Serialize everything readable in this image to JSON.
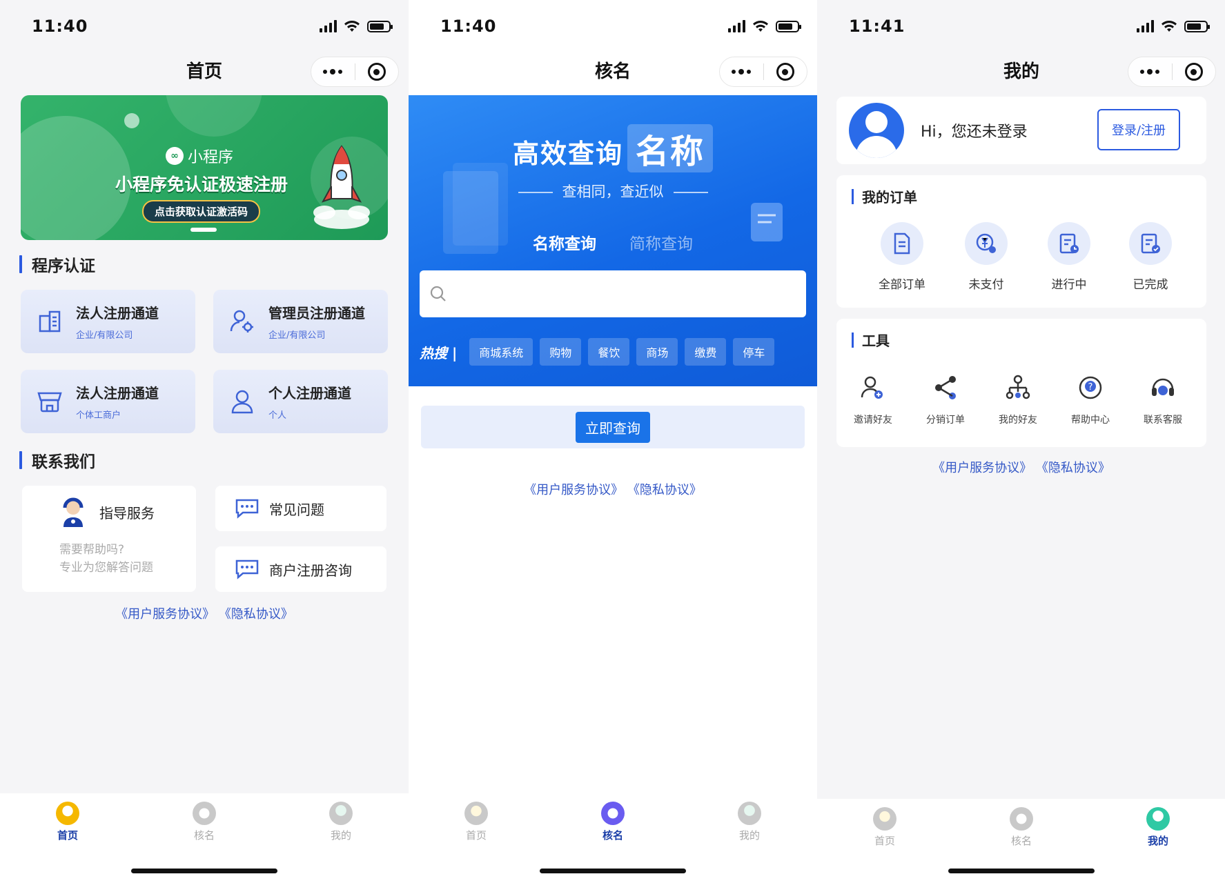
{
  "screens": [
    {
      "time": "11:40",
      "title": "首页",
      "banner": {
        "brand": "小程序",
        "headline": "小程序免认证极速注册",
        "cta": "点击获取认证激活码"
      },
      "section_auth": "程序认证",
      "auth_cards": [
        {
          "title": "法人注册通道",
          "sub": "企业/有限公司",
          "icon": "building-icon"
        },
        {
          "title": "管理员注册通道",
          "sub": "企业/有限公司",
          "icon": "admin-user-icon"
        },
        {
          "title": "法人注册通道",
          "sub": "个体工商户",
          "icon": "store-icon"
        },
        {
          "title": "个人注册通道",
          "sub": "个人",
          "icon": "person-icon"
        }
      ],
      "section_contact": "联系我们",
      "guide": {
        "title": "指导服务",
        "line1": "需要帮助吗?",
        "line2": "专业为您解答问题"
      },
      "faq": "常见问题",
      "merchant": "商户注册咨询",
      "agreement_user": "《用户服务协议》",
      "agreement_privacy": "《隐私协议》"
    },
    {
      "time": "11:40",
      "title": "核名",
      "hero_text": "高效查询",
      "hero_box": "名称",
      "hero_sub": "查相同，查近似",
      "tab_name": "名称查询",
      "tab_short": "简称查询",
      "search_placeholder": "",
      "hot_label": "热搜 |",
      "hot_tags": [
        "商城系统",
        "购物",
        "餐饮",
        "商场",
        "缴费",
        "停车"
      ],
      "query_button": "立即查询",
      "agreement_user": "《用户服务协议》",
      "agreement_privacy": "《隐私协议》"
    },
    {
      "time": "11:41",
      "title": "我的",
      "greeting": "Hi，您还未登录",
      "login_button": "登录/注册",
      "orders_title": "我的订单",
      "orders": [
        "全部订单",
        "未支付",
        "进行中",
        "已完成"
      ],
      "tools_title": "工具",
      "tools": [
        "邀请好友",
        "分销订单",
        "我的好友",
        "帮助中心",
        "联系客服"
      ],
      "agreement_user": "《用户服务协议》",
      "agreement_privacy": "《隐私协议》"
    }
  ],
  "tabbar": [
    "首页",
    "核名",
    "我的"
  ],
  "colors": {
    "accent_blue": "#2b5ae0",
    "hero_blue": "#1368e6",
    "banner_green": "#1e9a57",
    "tab_home_active": "#f5b800",
    "tab_search_active": "#6a5cf0",
    "tab_mine_active": "#2fc9a4"
  }
}
